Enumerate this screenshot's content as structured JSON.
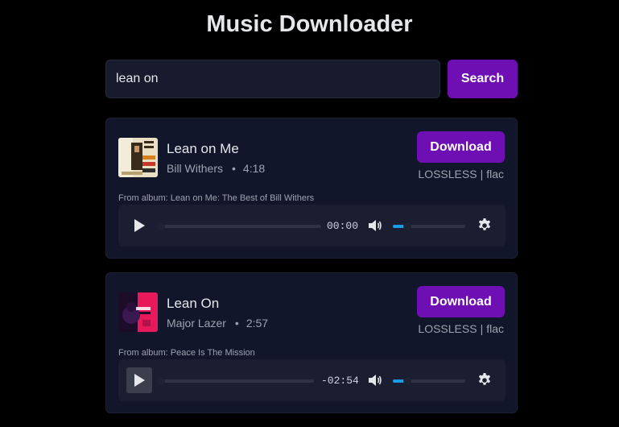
{
  "header": {
    "title": "Music Downloader"
  },
  "search": {
    "value": "lean on",
    "button_label": "Search"
  },
  "results": [
    {
      "title": "Lean on Me",
      "artist": "Bill Withers",
      "separator": "•",
      "duration": "4:18",
      "download_label": "Download",
      "quality": "LOSSLESS",
      "quality_sep": "|",
      "format": "flac",
      "album_prefix": "From album: ",
      "album": "Lean on Me: The Best of Bill Withers",
      "player": {
        "time": "00:00",
        "volume": 0.2
      }
    },
    {
      "title": "Lean On",
      "artist": "Major Lazer",
      "separator": "•",
      "duration": "2:57",
      "download_label": "Download",
      "quality": "LOSSLESS",
      "quality_sep": "|",
      "format": "flac",
      "album_prefix": "From album: ",
      "album": "Peace Is The Mission",
      "player": {
        "time": "-02:54",
        "volume": 0.2
      }
    }
  ],
  "colors": {
    "background": "#000000",
    "card": "#12162a",
    "accent": "#6d0fb2",
    "volume": "#1e9be6"
  }
}
